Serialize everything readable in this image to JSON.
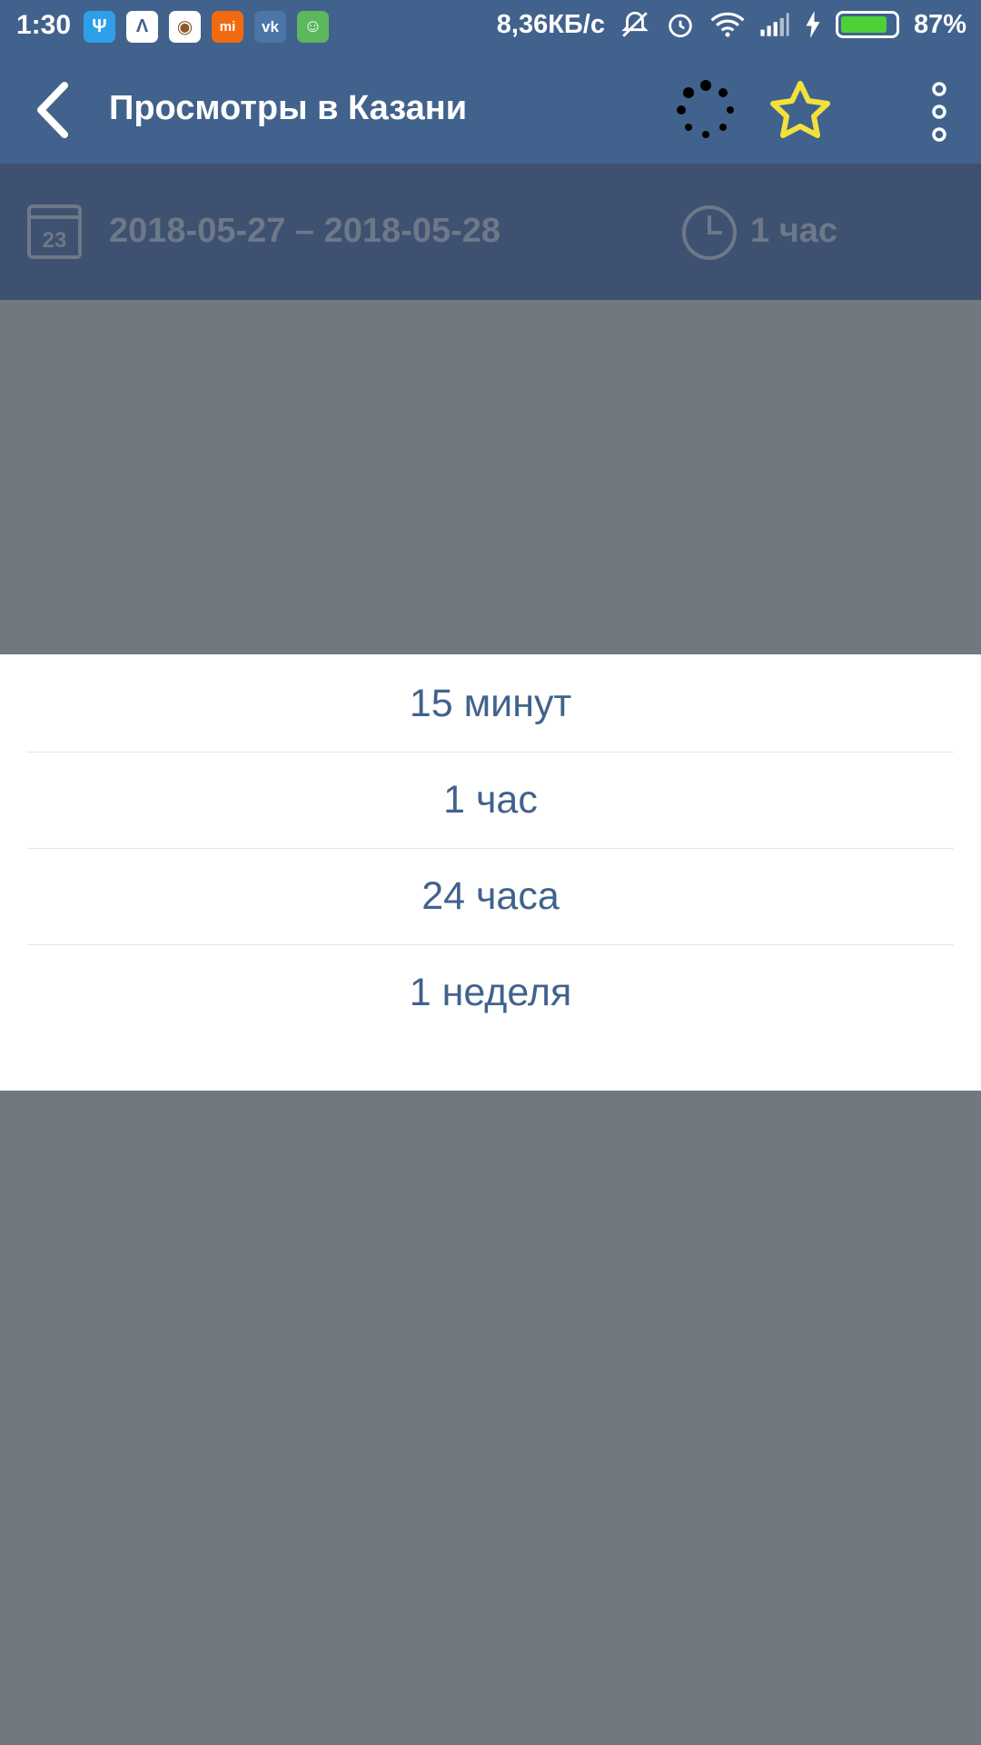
{
  "status_bar": {
    "time": "1:30",
    "apps": [
      {
        "icon": "usb-icon",
        "glyph": "Ψ",
        "color": "#2f9fe8"
      },
      {
        "icon": "arrow-app-icon",
        "glyph": "Λ",
        "color": "#ffffff"
      },
      {
        "icon": "cat-app-icon",
        "glyph": "◉",
        "color": "#ffffff"
      },
      {
        "icon": "mi-app-icon",
        "glyph": "mi",
        "color": "#f26a10"
      },
      {
        "icon": "vk-app-icon",
        "glyph": "vk",
        "color": "#4a76a8"
      },
      {
        "icon": "android-app-icon",
        "glyph": "☺",
        "color": "#5cb85c"
      }
    ],
    "net_speed": "8,36КБ/с",
    "battery_text": "87%",
    "battery_level": 0.87
  },
  "toolbar": {
    "title": "Просмотры в Казани",
    "star_color": "#f2e13c"
  },
  "filter": {
    "calendar_day": "23",
    "date_range": "2018-05-27 – 2018-05-28",
    "period": "1 час"
  },
  "picker": {
    "options": [
      "15 минут",
      "1 час",
      "24 часа",
      "1 неделя"
    ]
  },
  "colors": {
    "primary": "#41628c",
    "dim_overlay": "#717880",
    "option_text": "#41628c"
  }
}
